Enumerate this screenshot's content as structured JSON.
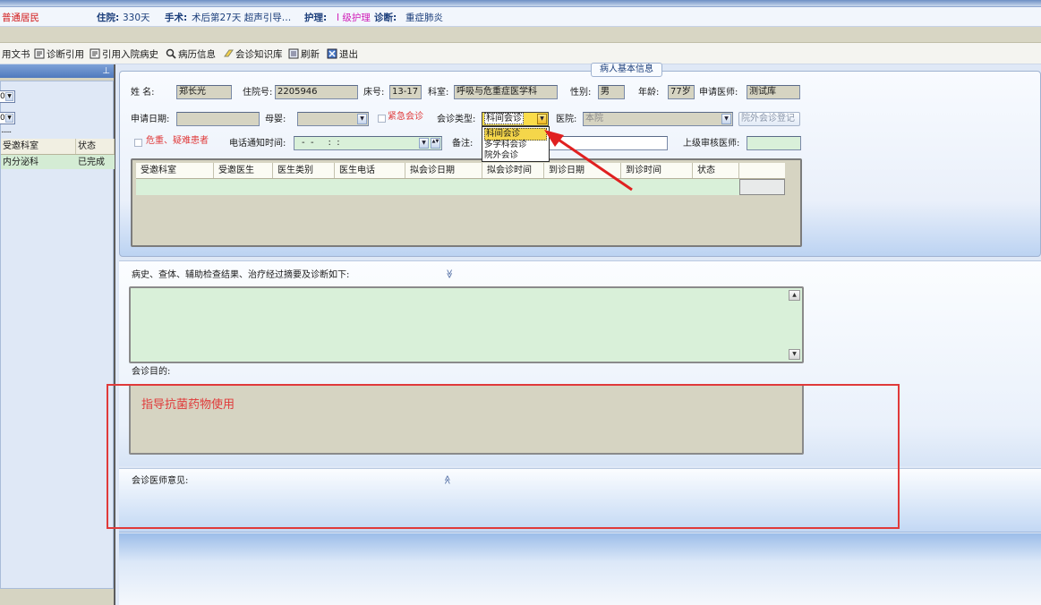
{
  "patient_bar": {
    "type_value": "普通居民",
    "stay_label": "住院:",
    "stay_value": "330天",
    "surgery_label": "手术:",
    "surgery_value": "术后第27天 超声引导…",
    "nursing_label": "护理:",
    "nursing_value": "I 级护理",
    "diagnosis_label": "诊断:",
    "diagnosis_value": "重症肺炎"
  },
  "toolbar": {
    "items": [
      {
        "label": "用文书",
        "icon": "document-icon"
      },
      {
        "label": "诊断引用",
        "icon": "import-icon"
      },
      {
        "label": "引用入院病史",
        "icon": "import-icon"
      },
      {
        "label": "病历信息",
        "icon": "search-icon"
      },
      {
        "label": "会诊知识库",
        "icon": "eraser-icon"
      },
      {
        "label": "刷新",
        "icon": "refresh-icon"
      },
      {
        "label": "退出",
        "icon": "exit-icon"
      }
    ]
  },
  "left_panel": {
    "pin_glyph": "⊥",
    "combo1_value": "0",
    "combo2_value": "0",
    "dots": "......",
    "table_headers": [
      "受邀科室",
      "状态"
    ],
    "rows": [
      [
        "内分泌科",
        "已完成"
      ]
    ]
  },
  "form": {
    "section_title": "病人基本信息",
    "name_label": "姓  名:",
    "name_value": "郑长光",
    "admission_no_label": "住院号:",
    "admission_no_value": "2205946",
    "bed_label": "床号:",
    "bed_value": "13-17",
    "dept_label": "科室:",
    "dept_value": "呼吸与危重症医学科",
    "gender_label": "性别:",
    "gender_value": "男",
    "age_label": "年龄:",
    "age_value": "77岁",
    "applicant_label": "申请医师:",
    "applicant_value": "测试库",
    "apply_date_label": "申请日期:",
    "apply_date_value": "",
    "infant_label": "母婴:",
    "urgent_label": "紧急会诊",
    "consult_type_label": "会诊类型:",
    "consult_type_value": "科间会诊",
    "hospital_label": "医院:",
    "hospital_value": "本院",
    "outside_button": "院外会诊登记",
    "critical_label": "危重、疑难患者",
    "phone_time_label": "电话通知时间:",
    "phone_time_value": "-  -     :  :",
    "remark_label": "备注:",
    "superior_label": "上级审核医师:",
    "dropdown_options": [
      "科间会诊",
      "多学科会诊",
      "院外会诊"
    ]
  },
  "grid": {
    "headers": [
      "受邀科室",
      "受邀医生",
      "医生类别",
      "医生电话",
      "拟会诊日期",
      "拟会诊时间",
      "到诊日期",
      "到诊时间",
      "状态"
    ]
  },
  "history": {
    "label": "病史、查体、辅助检查结果、治疗经过摘要及诊断如下:",
    "collapse_glyph": "≫"
  },
  "purpose": {
    "label": "会诊目的:",
    "value": "指导抗菌药物使用"
  },
  "opinion": {
    "label": "会诊医师意见:",
    "expand_glyph": "≫"
  },
  "colors": {
    "accent_red": "#e03a3a",
    "field_green": "#d9f0d9",
    "header_blue": "#1a3d7a"
  }
}
